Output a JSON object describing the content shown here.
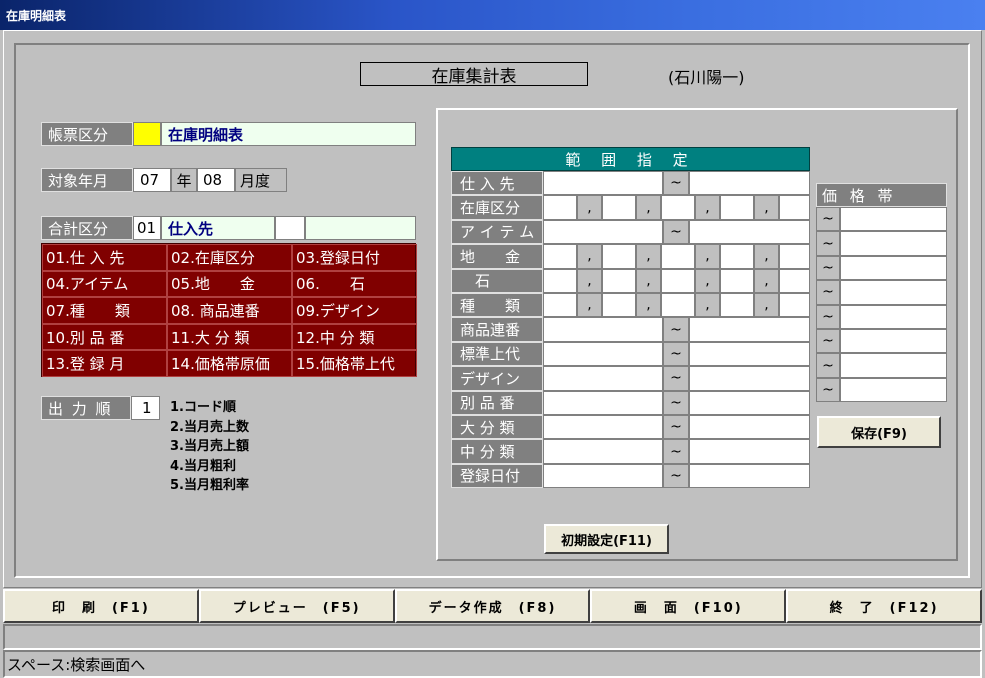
{
  "window": {
    "title": "在庫明細表"
  },
  "header": {
    "system_title": "在庫集計表",
    "user": "(石川陽一)"
  },
  "form": {
    "report_type": {
      "label": "帳票区分",
      "code": "",
      "value": "在庫明細表"
    },
    "target_month": {
      "label": "対象年月",
      "year": "07",
      "year_unit": "年",
      "month": "08",
      "month_unit": "月度"
    },
    "total_type": {
      "label": "合計区分",
      "code": "01",
      "value": "仕入先",
      "extra1": "",
      "extra2": ""
    },
    "total_options": [
      "01.仕 入 先",
      "02.在庫区分",
      "03.登録日付",
      "04.アイテム",
      "05.地　　金",
      "06.　　石",
      "07.種　　類",
      "08. 商品連番",
      "09.デザイン",
      "10.別 品 番",
      "11.大 分 類",
      "12.中 分 類",
      "13.登 録 月",
      "14.価格帯原価",
      "15.価格帯上代"
    ],
    "output_order": {
      "label": "出 力 順",
      "value": "1",
      "options": [
        "1.コード順",
        "2.当月売上数",
        "3.当月売上額",
        "4.当月粗利",
        "5.当月粗利率"
      ]
    }
  },
  "range": {
    "title": "範 囲 指 定",
    "tilde": "~",
    "comma": ",",
    "rows": [
      {
        "label": "仕 入 先",
        "kind": "range"
      },
      {
        "label": "在庫区分",
        "kind": "multi"
      },
      {
        "label": "ア イ テ ム",
        "kind": "range"
      },
      {
        "label": "地　　金",
        "kind": "multi"
      },
      {
        "label": "　石",
        "kind": "multi"
      },
      {
        "label": "種　　類",
        "kind": "multi"
      },
      {
        "label": "商品連番",
        "kind": "range"
      },
      {
        "label": "標準上代",
        "kind": "range"
      },
      {
        "label": "デザイン",
        "kind": "range"
      },
      {
        "label": "別 品 番",
        "kind": "range"
      },
      {
        "label": "大 分 類",
        "kind": "range"
      },
      {
        "label": "中 分 類",
        "kind": "range"
      },
      {
        "label": "登録日付",
        "kind": "range"
      }
    ],
    "init_button": "初期設定(F11)"
  },
  "price_band": {
    "title": "価 格 帯",
    "tilde": "~",
    "row_count": 8,
    "save_button": "保存(F9)"
  },
  "function_keys": [
    "印　刷　(F1)",
    "プレビュー　(F5)",
    "データ作成　(F8)",
    "画　面　(F10)",
    "終　了　(F12)"
  ],
  "status": {
    "line1": "",
    "line2": "スペース:検索画面へ"
  },
  "colors": {
    "title_bar": "#0a246a",
    "range_header": "#008080",
    "option_grid": "#800000",
    "yellow_code": "#ffff00",
    "mint_field": "#efffef"
  }
}
